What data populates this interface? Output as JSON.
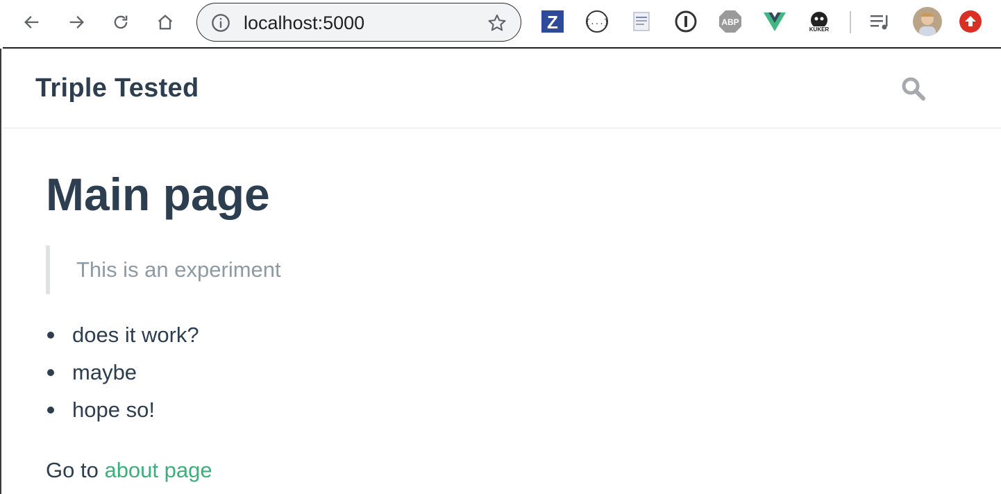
{
  "browser": {
    "url": "localhost:5000",
    "extensions": [
      "zotero-icon",
      "json-viewer-icon",
      "clipboard-icon",
      "onepassword-icon",
      "adblock-plus-icon",
      "vue-devtools-icon",
      "kuker-icon",
      "reading-list-icon",
      "profile-avatar",
      "update-icon"
    ],
    "extension_labels": {
      "zotero": "Z",
      "adblock": "ABP",
      "json": "{...}"
    }
  },
  "header": {
    "title": "Triple Tested"
  },
  "main": {
    "heading": "Main page",
    "quote": "This is an experiment",
    "items": [
      "does it work?",
      "maybe",
      "hope so!"
    ],
    "goto_prefix": "Go to",
    "goto_link": "about page"
  },
  "colors": {
    "text": "#2c3e50",
    "link": "#3eaf7c",
    "muted": "#8e9aa3"
  }
}
